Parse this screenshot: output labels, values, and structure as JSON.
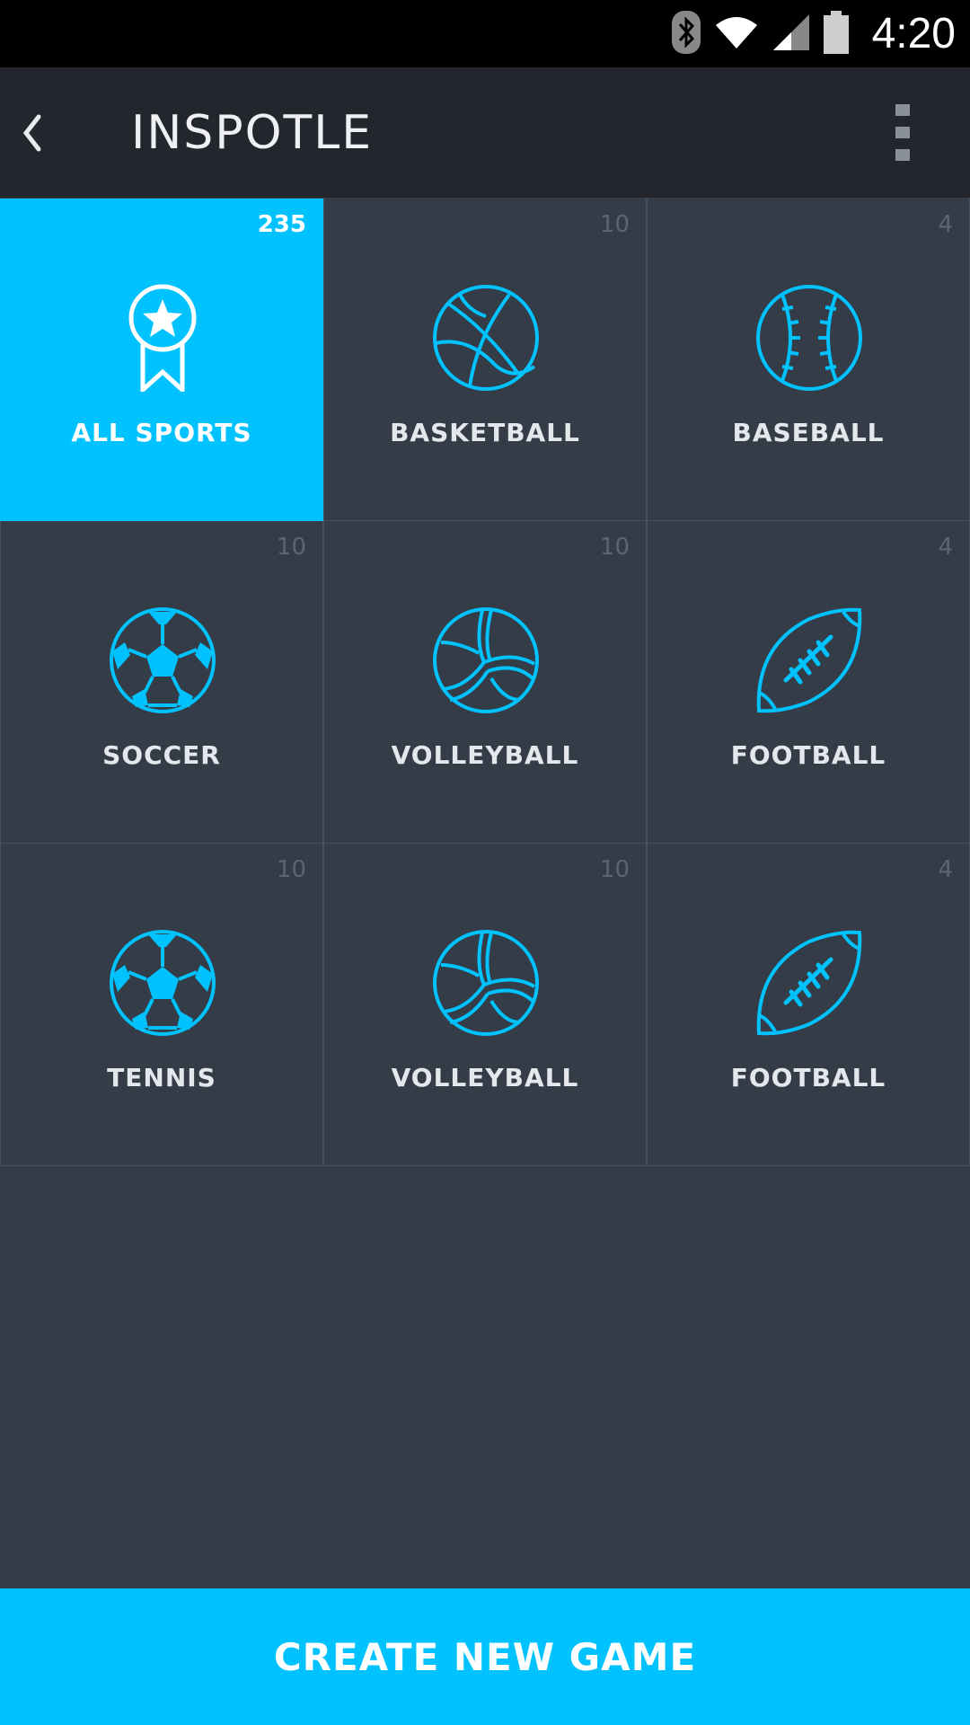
{
  "status_bar": {
    "time": "4:20",
    "icons": [
      "bluetooth-icon",
      "wifi-icon",
      "signal-icon",
      "battery-icon"
    ]
  },
  "app_bar": {
    "title": "INSPOTLE",
    "back_icon": "chevron-left-icon",
    "menu_icon": "more-vertical-icon"
  },
  "colors": {
    "accent": "#00c2ff",
    "background": "#343c47",
    "app_bar": "#23262c",
    "count_text": "#5b6472"
  },
  "tiles": [
    {
      "label": "ALL SPORTS",
      "count": "235",
      "icon": "award-ribbon-icon",
      "active": true
    },
    {
      "label": "BASKETBALL",
      "count": "10",
      "icon": "basketball-icon",
      "active": false
    },
    {
      "label": "BASEBALL",
      "count": "4",
      "icon": "baseball-icon",
      "active": false
    },
    {
      "label": "SOCCER",
      "count": "10",
      "icon": "soccer-ball-icon",
      "active": false
    },
    {
      "label": "VOLLEYBALL",
      "count": "10",
      "icon": "volleyball-icon",
      "active": false
    },
    {
      "label": "FOOTBALL",
      "count": "4",
      "icon": "football-icon",
      "active": false
    },
    {
      "label": "TENNIS",
      "count": "10",
      "icon": "soccer-ball-icon",
      "active": false
    },
    {
      "label": "VOLLEYBALL",
      "count": "10",
      "icon": "volleyball-icon",
      "active": false
    },
    {
      "label": "FOOTBALL",
      "count": "4",
      "icon": "football-icon",
      "active": false
    }
  ],
  "cta": {
    "label": "CREATE NEW GAME"
  }
}
